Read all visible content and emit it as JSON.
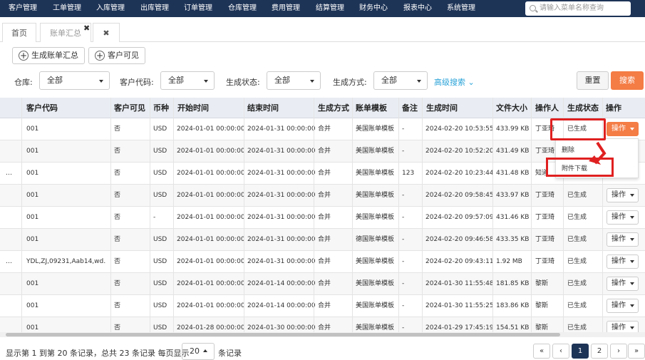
{
  "topnav": {
    "items": [
      "客户管理",
      "工单管理",
      "入库管理",
      "出库管理",
      "订单管理",
      "仓库管理",
      "费用管理",
      "结算管理",
      "财务中心",
      "报表中心",
      "系统管理"
    ],
    "search_placeholder": "请输入菜单名称查询"
  },
  "tabs": {
    "home": "首页",
    "billing": "账单汇总",
    "close_char": "✖"
  },
  "toolbar": {
    "generate": "生成账单汇总",
    "customer_visible": "客户可见"
  },
  "filters": {
    "warehouse_label": "仓库:",
    "warehouse_value": "全部",
    "customer_label": "客户代码:",
    "customer_value": "全部",
    "status_label": "生成状态:",
    "status_value": "全部",
    "method_label": "生成方式:",
    "method_value": "全部",
    "advanced": "高级搜索",
    "reset": "重置",
    "search": "搜索"
  },
  "table": {
    "headers": [
      "客户代码",
      "客户可见",
      "币种",
      "开始时间",
      "结束时间",
      "生成方式",
      "账单模板",
      "备注",
      "生成时间",
      "文件大小",
      "操作人",
      "生成状态",
      "操作"
    ],
    "op_label": "操作",
    "rows": [
      {
        "prefix": "",
        "code": "001",
        "visible": "否",
        "currency": "USD",
        "start": "2024-01-01 00:00:00",
        "end": "2024-01-31 00:00:00",
        "method": "合并",
        "template": "美国账单模板",
        "note": "-",
        "gen": "2024-02-20 10:53:55",
        "size": "433.99 KB",
        "operator": "丁亚琦",
        "status": "已生成"
      },
      {
        "prefix": "",
        "code": "001",
        "visible": "否",
        "currency": "USD",
        "start": "2024-01-01 00:00:00",
        "end": "2024-01-31 00:00:00",
        "method": "合并",
        "template": "美国账单模板",
        "note": "-",
        "gen": "2024-02-20 10:52:20",
        "size": "431.49 KB",
        "operator": "丁亚琦",
        "status": ""
      },
      {
        "prefix": "…",
        "code": "001",
        "visible": "否",
        "currency": "USD",
        "start": "2024-01-01 00:00:00",
        "end": "2024-01-31 00:00:00",
        "method": "合并",
        "template": "美国账单模板",
        "note": "123",
        "gen": "2024-02-20 10:23:44",
        "size": "431.48 KB",
        "operator": "知道",
        "status": ""
      },
      {
        "prefix": "",
        "code": "001",
        "visible": "否",
        "currency": "USD",
        "start": "2024-01-01 00:00:00",
        "end": "2024-01-31 00:00:00",
        "method": "合并",
        "template": "美国账单模板",
        "note": "-",
        "gen": "2024-02-20 09:58:45",
        "size": "433.97 KB",
        "operator": "丁亚琦",
        "status": "已生成"
      },
      {
        "prefix": "",
        "code": "001",
        "visible": "否",
        "currency": "-",
        "start": "2024-01-01 00:00:00",
        "end": "2024-01-31 00:00:00",
        "method": "合并",
        "template": "美国账单模板",
        "note": "-",
        "gen": "2024-02-20 09:57:09",
        "size": "431.46 KB",
        "operator": "丁亚琦",
        "status": "已生成"
      },
      {
        "prefix": "",
        "code": "001",
        "visible": "否",
        "currency": "USD",
        "start": "2024-01-01 00:00:00",
        "end": "2024-01-31 00:00:00",
        "method": "合并",
        "template": "德国账单模板",
        "note": "-",
        "gen": "2024-02-20 09:46:58",
        "size": "433.35 KB",
        "operator": "丁亚琦",
        "status": "已生成"
      },
      {
        "prefix": "…",
        "code": "YDL,ZJ,09231,Aab14,wd…",
        "visible": "否",
        "currency": "USD",
        "start": "2024-01-01 00:00:00",
        "end": "2024-01-31 00:00:00",
        "method": "合并",
        "template": "美国账单模板",
        "note": "-",
        "gen": "2024-02-20 09:43:11",
        "size": "1.92 MB",
        "operator": "丁亚琦",
        "status": "已生成"
      },
      {
        "prefix": "",
        "code": "001",
        "visible": "否",
        "currency": "USD",
        "start": "2024-01-01 00:00:00",
        "end": "2024-01-14 00:00:00",
        "method": "合并",
        "template": "美国账单模板",
        "note": "-",
        "gen": "2024-01-30 11:55:48",
        "size": "181.85 KB",
        "operator": "黎斯",
        "status": "已生成"
      },
      {
        "prefix": "",
        "code": "001",
        "visible": "否",
        "currency": "USD",
        "start": "2024-01-01 00:00:00",
        "end": "2024-01-14 00:00:00",
        "method": "合并",
        "template": "美国账单模板",
        "note": "-",
        "gen": "2024-01-30 11:55:25",
        "size": "183.86 KB",
        "operator": "黎斯",
        "status": "已生成"
      },
      {
        "prefix": "",
        "code": "001",
        "visible": "否",
        "currency": "USD",
        "start": "2024-01-28 00:00:00",
        "end": "2024-01-30 00:00:00",
        "method": "合并",
        "template": "美国账单模板",
        "note": "-",
        "gen": "2024-01-29 17:45:19",
        "size": "154.51 KB",
        "operator": "黎斯",
        "status": "已生成"
      }
    ]
  },
  "dropdown": {
    "delete": "删除",
    "download": "附件下载"
  },
  "footer": {
    "summary": "显示第 1 到第 20 条记录，总共 23 条记录 每页显示",
    "page_size": "20",
    "per_page_suffix": "条记录",
    "pages": [
      "«",
      "‹",
      "1",
      "2",
      "›",
      "»"
    ]
  },
  "colors": {
    "nav_bg": "#1e3457",
    "accent": "#f47c45",
    "highlight": "#e02020"
  }
}
